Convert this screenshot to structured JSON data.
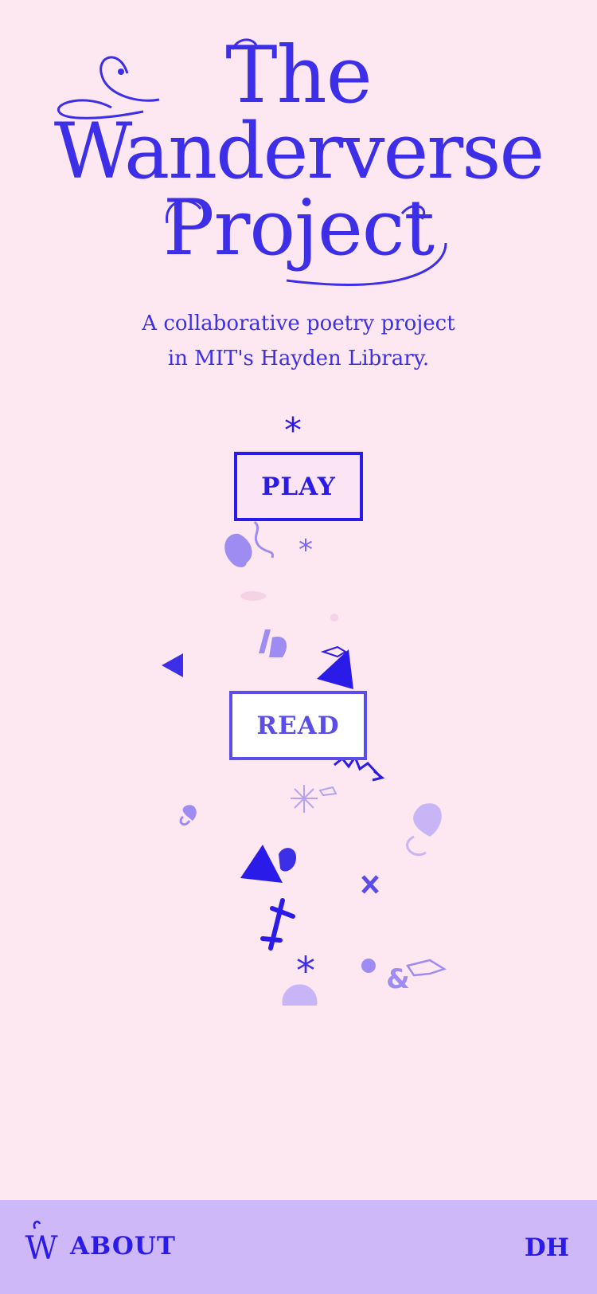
{
  "title": {
    "line1": "The",
    "line2": "Wanderverse",
    "line3": "Project"
  },
  "subtitle": {
    "line1": "A collaborative poetry project",
    "line2": "in MIT's Hayden Library."
  },
  "buttons": {
    "play_label": "PLAY",
    "read_label": "READ"
  },
  "footer": {
    "logo_letter": "W",
    "about_label": "ABOUT",
    "dh_label": "DH"
  },
  "colors": {
    "background": "#fde8f2",
    "accent": "#3d2ee8",
    "accent_dark": "#2b1be8",
    "accent_light": "#9f8cf2",
    "footer_bg": "#cfb8f7"
  },
  "decorations": [
    "asterisk-icon",
    "heart-icon",
    "triangle-icon",
    "pointing-hand-icon",
    "cross-icon",
    "ampersand-icon",
    "starburst-icon",
    "squiggle-icon",
    "circle-icon"
  ]
}
